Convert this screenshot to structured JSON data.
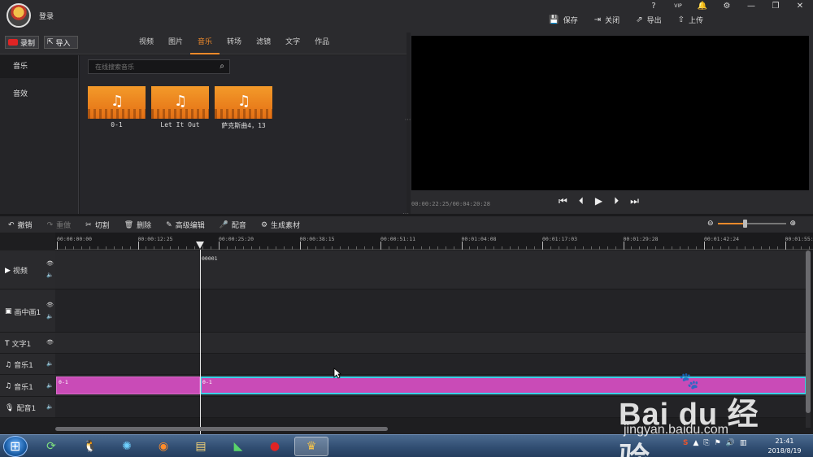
{
  "topbar": {
    "login": "登录",
    "actions": [
      {
        "icon": "save-icon",
        "glyph": "💾",
        "label": "保存"
      },
      {
        "icon": "close-doc-icon",
        "glyph": "⇥",
        "label": "关闭"
      },
      {
        "icon": "export-icon",
        "glyph": "⇗",
        "label": "导出"
      },
      {
        "icon": "upload-icon",
        "glyph": "⇧",
        "label": "上传"
      }
    ],
    "window_controls": [
      "?",
      "VIP",
      "🔔",
      "⚙",
      "—",
      "❐",
      "✕"
    ]
  },
  "library": {
    "record_label": "录制",
    "import_label": "导入",
    "categories": [
      "视频",
      "图片",
      "音乐",
      "转场",
      "滤镜",
      "文字",
      "作品"
    ],
    "active_category": "音乐",
    "side_items": [
      "音乐",
      "音效"
    ],
    "search_placeholder": "在线搜索音乐",
    "items": [
      {
        "caption": "0-1"
      },
      {
        "caption": "Let It Out"
      },
      {
        "caption": "萨克斯曲4，13"
      }
    ]
  },
  "preview": {
    "timecode": "00:00:22:25/00:04:20:28",
    "transport": [
      "⏮",
      "⏴",
      "▶",
      "⏵",
      "⏭"
    ]
  },
  "toolbar": {
    "tools": [
      {
        "icon": "undo-icon",
        "glyph": "↶",
        "label": "撤销",
        "enabled": true
      },
      {
        "icon": "redo-icon",
        "glyph": "↷",
        "label": "重做",
        "enabled": false
      },
      {
        "icon": "cut-icon",
        "glyph": "✂",
        "label": "切割",
        "enabled": true
      },
      {
        "icon": "delete-icon",
        "glyph": "🗑",
        "label": "删除",
        "enabled": true
      },
      {
        "icon": "edit-icon",
        "glyph": "✎",
        "label": "高级编辑",
        "enabled": true
      },
      {
        "icon": "mic-icon",
        "glyph": "🎤",
        "label": "配音",
        "enabled": true
      },
      {
        "icon": "generate-icon",
        "glyph": "⚙",
        "label": "生成素材",
        "enabled": true
      }
    ],
    "zoom_level": 0.4
  },
  "timeline": {
    "ruler_labels": [
      "00:00:00:00",
      "00:00:12:25",
      "00:00:25:20",
      "00:00:38:15",
      "00:00:51:11",
      "00:01:04:08",
      "00:01:17:03",
      "00:01:29:28",
      "00:01:42:24",
      "00:01:55:"
    ],
    "marker_label": "00001",
    "tracks": [
      {
        "name": "视频",
        "icon": "video-track-icon",
        "glyph": "▶",
        "eye": true,
        "volume": true
      },
      {
        "name": "画中画1",
        "icon": "pip-track-icon",
        "glyph": "▣",
        "eye": true,
        "volume": true
      },
      {
        "name": "文字1",
        "icon": "text-track-icon",
        "glyph": "T",
        "eye": true,
        "volume": false
      },
      {
        "name": "音乐1",
        "icon": "music-track-icon",
        "glyph": "♫",
        "eye": false,
        "volume": true
      },
      {
        "name": "音乐1",
        "icon": "music-track-icon",
        "glyph": "♫",
        "eye": false,
        "volume": true
      },
      {
        "name": "配音1",
        "icon": "mic-track-icon",
        "glyph": "🎙",
        "eye": false,
        "volume": true
      }
    ],
    "clips": [
      {
        "label": "0-1"
      },
      {
        "label": "0-1"
      }
    ]
  },
  "taskbar": {
    "time": "21:41",
    "date": "2018/8/19",
    "ime": "S"
  },
  "watermark": {
    "logo": "Bai du 经验",
    "url": "jingyan.baidu.com"
  }
}
